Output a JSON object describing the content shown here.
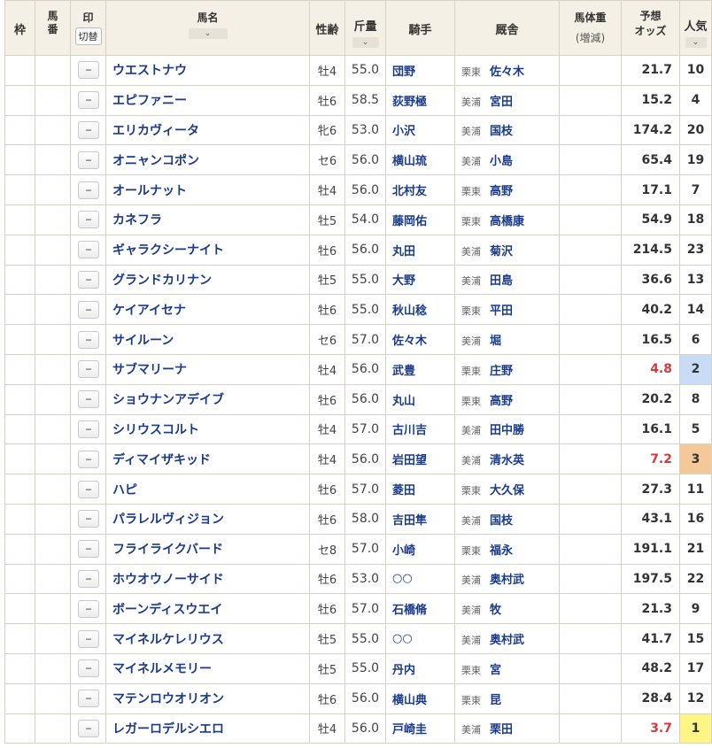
{
  "header": {
    "waku": "枠",
    "umaban": "馬番",
    "mark": "印",
    "mark_toggle": "切替",
    "horse_name": "馬名",
    "sex_age": "性齢",
    "weight": "斤量",
    "jockey": "騎手",
    "stable": "厩舎",
    "body_weight": "馬体重",
    "body_weight_sub": "(増減)",
    "odds": "予想オッズ",
    "odds_line1": "予想",
    "odds_line2": "オッズ",
    "popularity": "人気",
    "sort_icon": "chevron-down-icon"
  },
  "mark_default": "--",
  "colors": {
    "popularity_1": "#fff585",
    "popularity_2": "#c8dcf8",
    "popularity_3": "#f5c898",
    "hot_odds": "#d23c3c",
    "link": "#1a3a8c"
  },
  "rows": [
    {
      "name": "ウエストナウ",
      "sex_age": "牡4",
      "weight": "55.0",
      "jockey": "団野",
      "region": "栗東",
      "trainer": "佐々木",
      "odds": "21.7",
      "pop": "10"
    },
    {
      "name": "エピファニー",
      "sex_age": "牡6",
      "weight": "58.5",
      "jockey": "荻野極",
      "region": "美浦",
      "trainer": "宮田",
      "odds": "15.2",
      "pop": "4"
    },
    {
      "name": "エリカヴィータ",
      "sex_age": "牝6",
      "weight": "53.0",
      "jockey": "小沢",
      "region": "美浦",
      "trainer": "国枝",
      "odds": "174.2",
      "pop": "20"
    },
    {
      "name": "オニャンコポン",
      "sex_age": "セ6",
      "weight": "56.0",
      "jockey": "横山琉",
      "region": "美浦",
      "trainer": "小島",
      "odds": "65.4",
      "pop": "19"
    },
    {
      "name": "オールナット",
      "sex_age": "牡4",
      "weight": "56.0",
      "jockey": "北村友",
      "region": "栗東",
      "trainer": "高野",
      "odds": "17.1",
      "pop": "7"
    },
    {
      "name": "カネフラ",
      "sex_age": "牡5",
      "weight": "54.0",
      "jockey": "藤岡佑",
      "region": "栗東",
      "trainer": "高橋康",
      "odds": "54.9",
      "pop": "18"
    },
    {
      "name": "ギャラクシーナイト",
      "sex_age": "牡6",
      "weight": "56.0",
      "jockey": "丸田",
      "region": "美浦",
      "trainer": "菊沢",
      "odds": "214.5",
      "pop": "23"
    },
    {
      "name": "グランドカリナン",
      "sex_age": "牡5",
      "weight": "55.0",
      "jockey": "大野",
      "region": "美浦",
      "trainer": "田島",
      "odds": "36.6",
      "pop": "13"
    },
    {
      "name": "ケイアイセナ",
      "sex_age": "牡6",
      "weight": "55.0",
      "jockey": "秋山稔",
      "region": "栗東",
      "trainer": "平田",
      "odds": "40.2",
      "pop": "14"
    },
    {
      "name": "サイルーン",
      "sex_age": "セ6",
      "weight": "57.0",
      "jockey": "佐々木",
      "region": "美浦",
      "trainer": "堀",
      "odds": "16.5",
      "pop": "6"
    },
    {
      "name": "サブマリーナ",
      "sex_age": "牡4",
      "weight": "56.0",
      "jockey": "武豊",
      "region": "栗東",
      "trainer": "庄野",
      "odds": "4.8",
      "pop": "2"
    },
    {
      "name": "ショウナンアデイブ",
      "sex_age": "牡6",
      "weight": "56.0",
      "jockey": "丸山",
      "region": "栗東",
      "trainer": "高野",
      "odds": "20.2",
      "pop": "8"
    },
    {
      "name": "シリウスコルト",
      "sex_age": "牡4",
      "weight": "57.0",
      "jockey": "古川吉",
      "region": "美浦",
      "trainer": "田中勝",
      "odds": "16.1",
      "pop": "5"
    },
    {
      "name": "ディマイザキッド",
      "sex_age": "牡4",
      "weight": "56.0",
      "jockey": "岩田望",
      "region": "美浦",
      "trainer": "清水英",
      "odds": "7.2",
      "pop": "3"
    },
    {
      "name": "ハピ",
      "sex_age": "牡6",
      "weight": "57.0",
      "jockey": "菱田",
      "region": "栗東",
      "trainer": "大久保",
      "odds": "27.3",
      "pop": "11"
    },
    {
      "name": "パラレルヴィジョン",
      "sex_age": "牡6",
      "weight": "58.0",
      "jockey": "吉田隼",
      "region": "美浦",
      "trainer": "国枝",
      "odds": "43.1",
      "pop": "16"
    },
    {
      "name": "フライライクバード",
      "sex_age": "セ8",
      "weight": "57.0",
      "jockey": "小崎",
      "region": "栗東",
      "trainer": "福永",
      "odds": "191.1",
      "pop": "21"
    },
    {
      "name": "ホウオウノーサイド",
      "sex_age": "牡6",
      "weight": "53.0",
      "jockey": "○○",
      "region": "美浦",
      "trainer": "奥村武",
      "odds": "197.5",
      "pop": "22"
    },
    {
      "name": "ボーンディスウエイ",
      "sex_age": "牡6",
      "weight": "57.0",
      "jockey": "石橋脩",
      "region": "美浦",
      "trainer": "牧",
      "odds": "21.3",
      "pop": "9"
    },
    {
      "name": "マイネルケレリウス",
      "sex_age": "牡5",
      "weight": "55.0",
      "jockey": "○○",
      "region": "美浦",
      "trainer": "奥村武",
      "odds": "41.7",
      "pop": "15"
    },
    {
      "name": "マイネルメモリー",
      "sex_age": "牡5",
      "weight": "55.0",
      "jockey": "丹内",
      "region": "栗東",
      "trainer": "宮",
      "odds": "48.2",
      "pop": "17"
    },
    {
      "name": "マテンロウオリオン",
      "sex_age": "牡6",
      "weight": "56.0",
      "jockey": "横山典",
      "region": "栗東",
      "trainer": "昆",
      "odds": "28.4",
      "pop": "12"
    },
    {
      "name": "レガーロデルシエロ",
      "sex_age": "牡4",
      "weight": "56.0",
      "jockey": "戸崎圭",
      "region": "美浦",
      "trainer": "栗田",
      "odds": "3.7",
      "pop": "1"
    }
  ]
}
